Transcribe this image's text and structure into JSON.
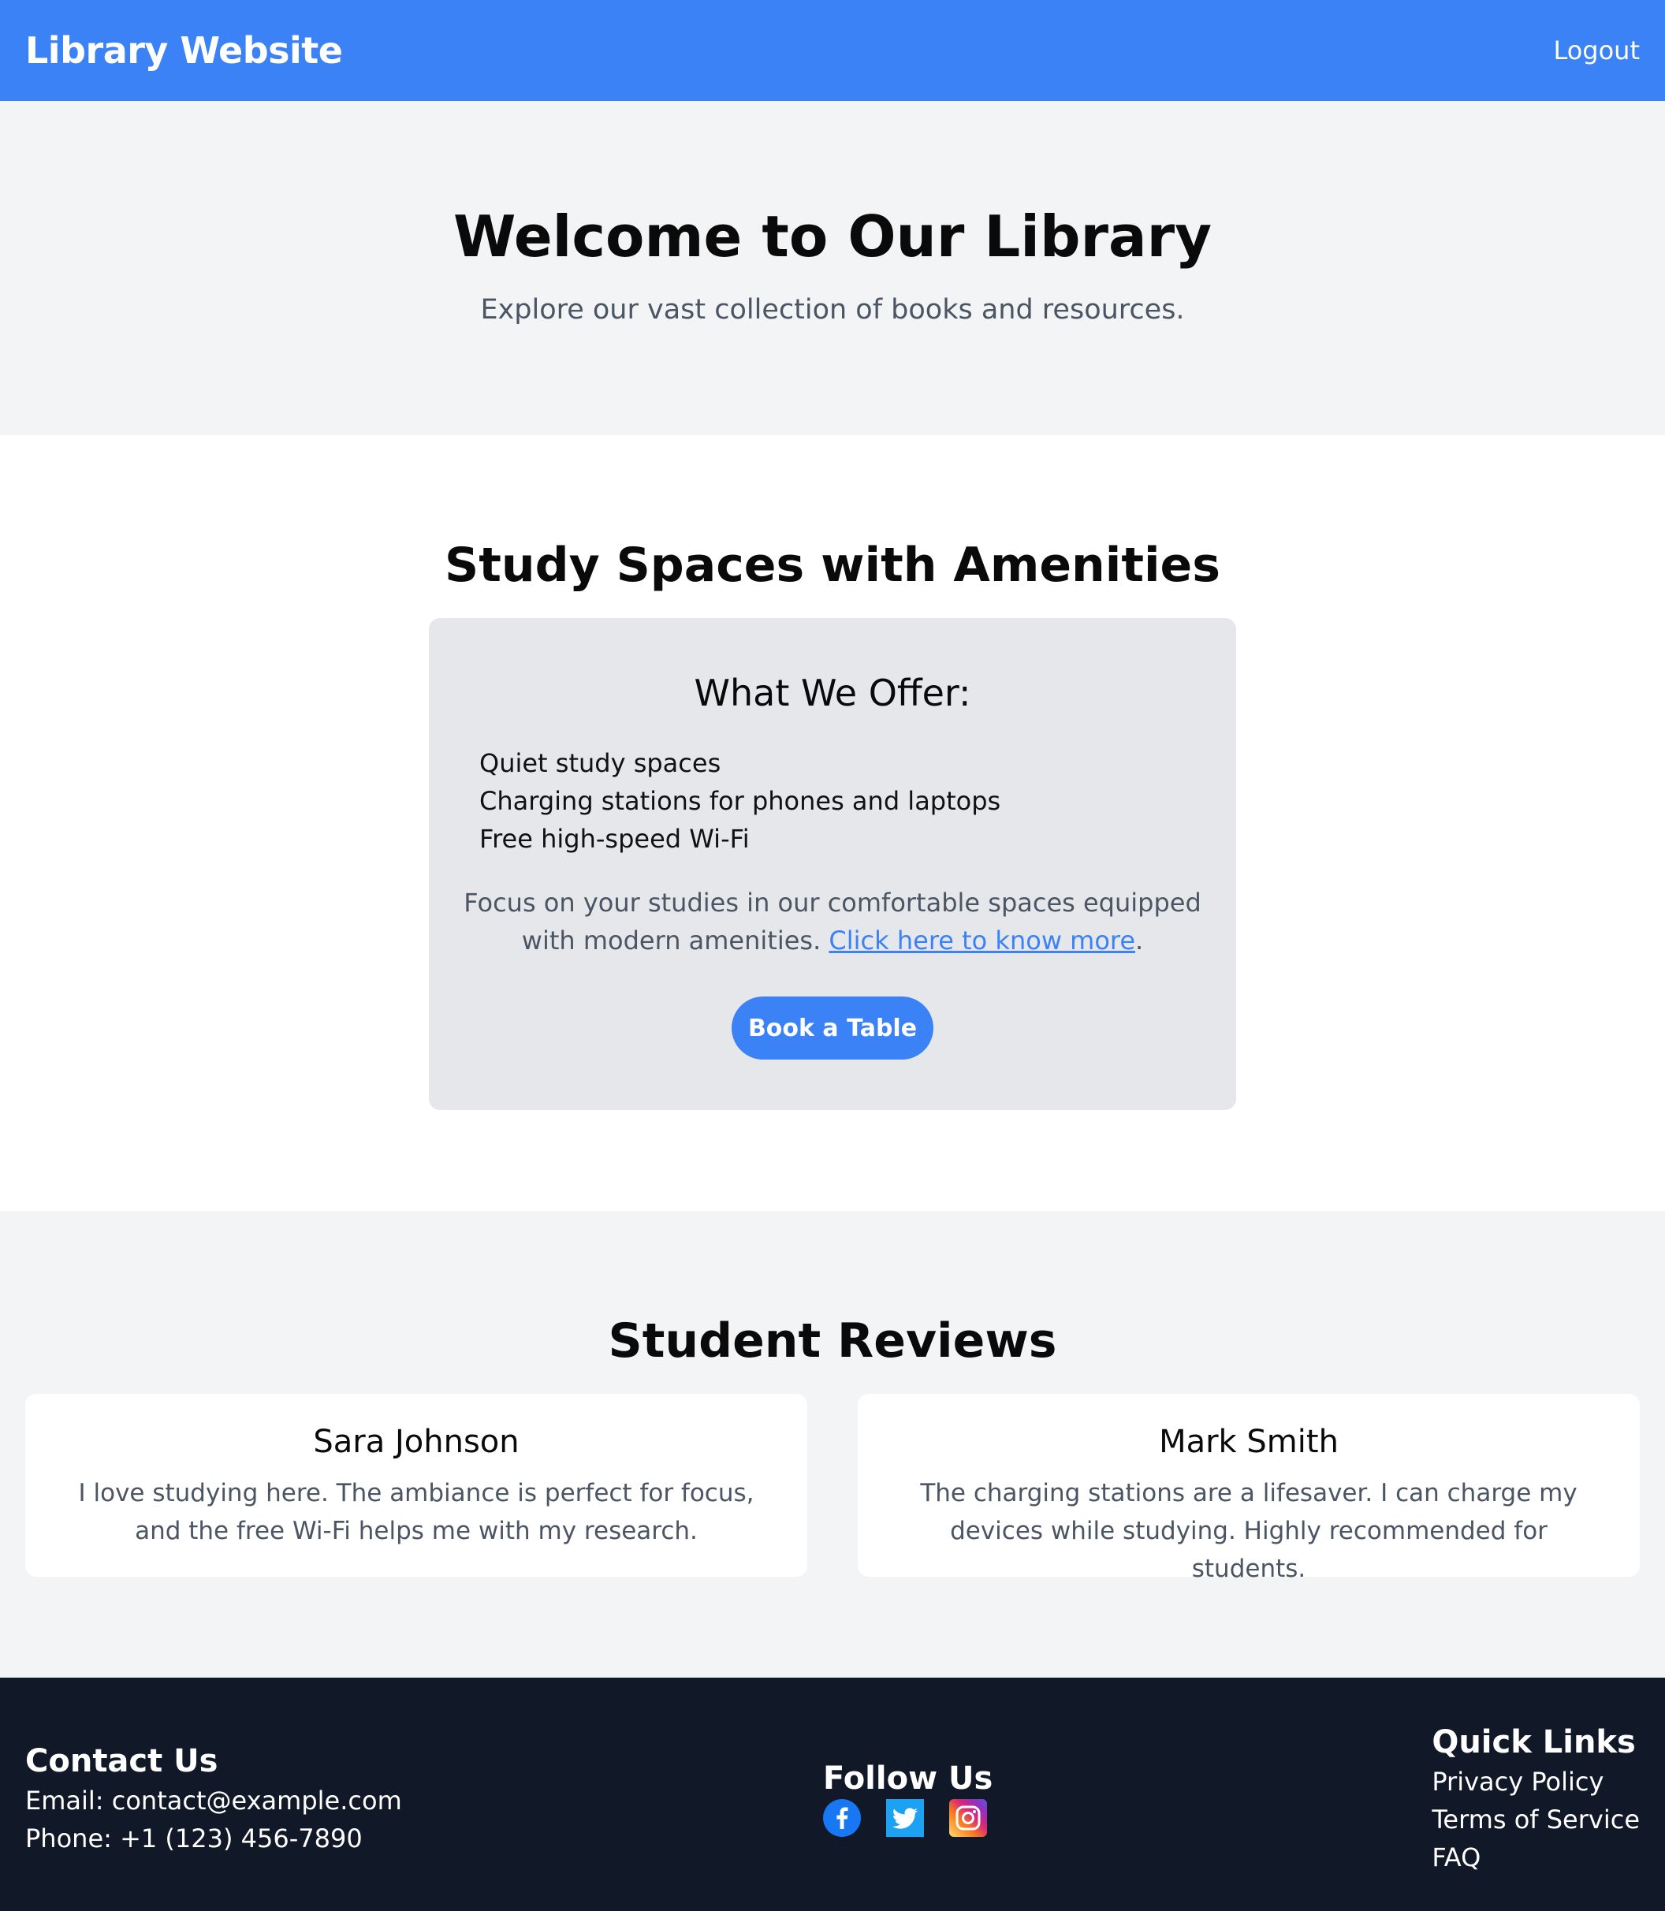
{
  "header": {
    "brand": "Library Website",
    "logout_label": "Logout"
  },
  "hero": {
    "title": "Welcome to Our Library",
    "subtitle": "Explore our vast collection of books and resources."
  },
  "study": {
    "title": "Study Spaces with Amenities",
    "card_title": "What We Offer:",
    "items": [
      "Quiet study spaces",
      "Charging stations for phones and laptops",
      "Free high-speed Wi-Fi"
    ],
    "description": "Focus on your studies in our comfortable spaces equipped with modern amenities. ",
    "link_label": "Click here to know more",
    "description_end": ".",
    "button_label": "Book a Table"
  },
  "reviews": {
    "title": "Student Reviews",
    "items": [
      {
        "name": "Sara Johnson",
        "text": "I love studying here. The ambiance is perfect for focus, and the free Wi-Fi helps me with my research."
      },
      {
        "name": "Mark Smith",
        "text": "The charging stations are a lifesaver. I can charge my devices while studying. Highly recommended for students."
      }
    ]
  },
  "footer": {
    "contact_title": "Contact Us",
    "email": "Email: contact@example.com",
    "phone": "Phone: +1 (123) 456-7890",
    "follow_title": "Follow Us",
    "social_icons": [
      "facebook-icon",
      "twitter-icon",
      "instagram-icon"
    ],
    "quick_title": "Quick Links",
    "quick_links": [
      "Privacy Policy",
      "Terms of Service",
      "FAQ"
    ]
  },
  "colors": {
    "accent": "#3b82f6",
    "footer_bg": "#111827",
    "card_bg": "#e5e7eb",
    "page_bg": "#f3f4f6"
  }
}
